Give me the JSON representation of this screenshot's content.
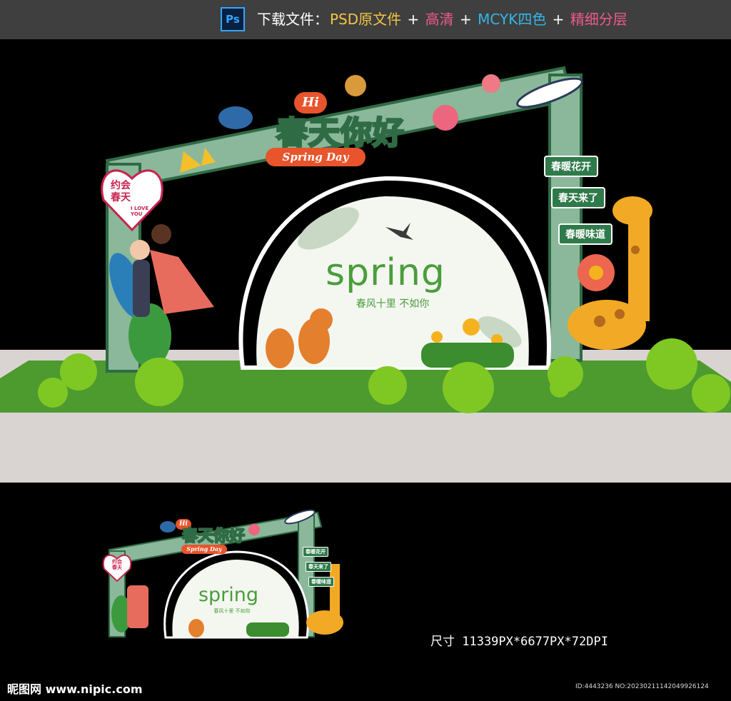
{
  "topbar": {
    "ps_icon_label": "Ps",
    "download_label": "下载文件：",
    "psd": "PSD原文件",
    "plus1": " + ",
    "hd": "高清",
    "plus2": " + ",
    "cmyk": "MCYK四色",
    "plus3": " + ",
    "layers": "精细分层",
    "colors": {
      "psd": "#f3c443",
      "hd": "#ee5a8a",
      "cmyk": "#34b6e8",
      "layers": "#ee5a8a",
      "label": "#ffffff"
    }
  },
  "design": {
    "hi": "Hi",
    "title": "春天你好",
    "subtitle": "Spring Day",
    "heart_text": "约会春天",
    "heart_small": "I LOVE YOU",
    "signs": [
      "春暖花开",
      "春天来了",
      "春暖味道"
    ],
    "spring_word": "spring",
    "slogan": "春风十里  不如你",
    "colors": {
      "frame": "#8bb89a",
      "frame_dark": "#2f6b45",
      "grass": "#4d9a2f",
      "ball": "#7fc824",
      "accent": "#e8542c",
      "floor": "#d9d4d2"
    }
  },
  "footer": {
    "size_label": "尺寸 11339PX*6677PX*72DPI",
    "watermark": "昵图网 www.nipic.com",
    "id_text": "ID:4443236 NO:20230211142049926124"
  }
}
